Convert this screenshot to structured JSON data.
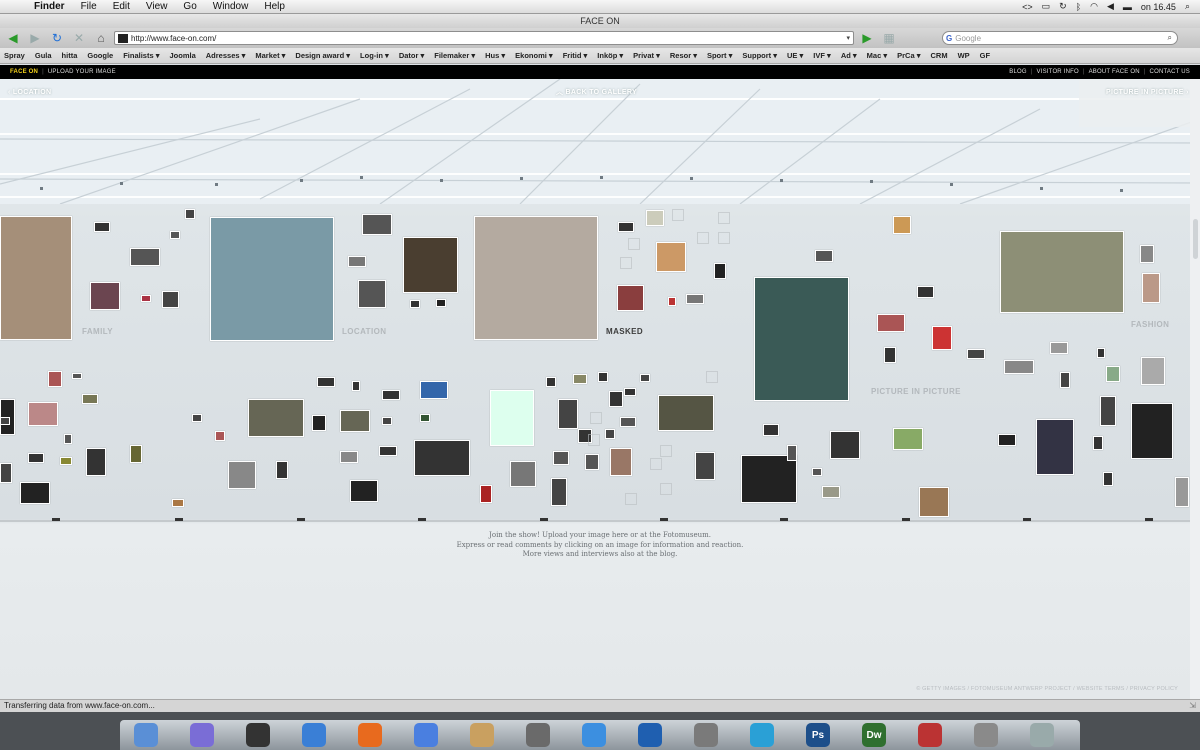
{
  "menubar": {
    "items": [
      "Finder",
      "File",
      "Edit",
      "View",
      "Go",
      "Window",
      "Help"
    ],
    "clock": "on 16.45"
  },
  "window": {
    "title": "FACE ON"
  },
  "toolbar": {
    "url": "http://www.face-on.com/",
    "search_placeholder": "Google"
  },
  "bookmarks": [
    "Spray",
    "Gula",
    "hitta",
    "Google",
    "Finalists ▾",
    "Joomla",
    "Adresses ▾",
    "Market ▾",
    "Design award ▾",
    "Log-in ▾",
    "Dator ▾",
    "Filemaker ▾",
    "Hus ▾",
    "Ekonomi ▾",
    "Fritid ▾",
    "Inköp ▾",
    "Privat ▾",
    "Resor ▾",
    "Sport ▾",
    "Support ▾",
    "UE ▾",
    "IVF ▾",
    "Ad ▾",
    "Mac ▾",
    "PrCa ▾",
    "CRM",
    "WP",
    "GF"
  ],
  "sitenav": {
    "brand": "FACE ON",
    "upload": "UPLOAD YOUR IMAGE",
    "right": [
      "BLOG",
      "VISITOR INFO",
      "ABOUT FACE ON",
      "CONTACT US"
    ]
  },
  "gallery": {
    "nav_left": "LOCATION",
    "nav_center": "BACK TO GALLERY",
    "nav_right": "PICTURE IN PICTURE",
    "categories": {
      "family": "FAMILY",
      "location": "LOCATION",
      "masked": "MASKED",
      "pip": "PICTURE IN PICTURE",
      "fashion": "FASHION"
    },
    "info": [
      "Join the show! Upload your image here or at the Fotomuseum.",
      "Express or read comments by clicking on an image for information and reaction.",
      "More views and interviews also at the blog."
    ],
    "footer": "© GETTY IMAGES / FOTOMUSEUM ANTWERP PROJECT / WEBSITE TERMS / PRIVACY POLICY"
  },
  "status": {
    "text": "Transferring data from www.face-on.com..."
  },
  "dock": {
    "apps": [
      "finder-icon",
      "ichat-icon",
      "dashboard-icon",
      "safari-icon",
      "firefox-icon",
      "itunes-icon",
      "iphoto-icon",
      "imovie-icon",
      "ical-icon",
      "quicktime-icon",
      "preview-icon",
      "skype-icon",
      "photoshop-icon",
      "dreamweaver-icon",
      "filezilla-icon",
      "system-preferences-icon",
      "trash-icon"
    ],
    "labels": {
      "ps": "Ps",
      "dw": "Dw"
    }
  }
}
